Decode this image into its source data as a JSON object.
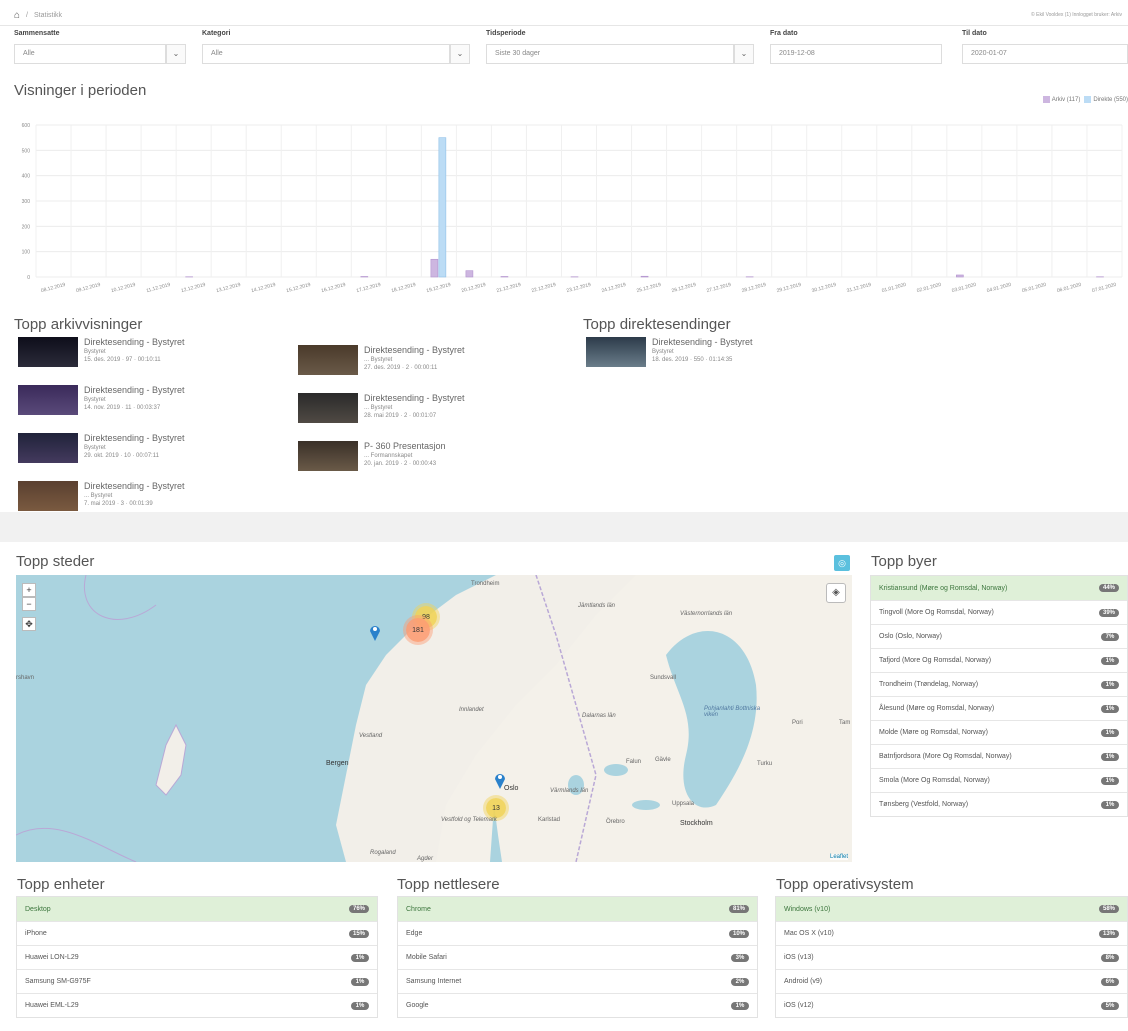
{
  "breadcrumb": {
    "home_icon": "home-icon",
    "current": "Statistikk"
  },
  "header_right": "© Ekil Vooldex (1) Innlogget bruker: Arkiv",
  "filters": {
    "sammensatt": {
      "label": "Sammensatte",
      "value": "Alle"
    },
    "kategori": {
      "label": "Kategori",
      "value": "Alle"
    },
    "tidsperiode": {
      "label": "Tidsperiode",
      "value": "Siste 30 dager"
    },
    "fra_dato": {
      "label": "Fra dato",
      "value": "2019-12-08"
    },
    "til_dato": {
      "label": "Til dato",
      "value": "2020-01-07"
    }
  },
  "views": {
    "title": "Visninger i perioden",
    "legend": [
      "Arkiv (117)",
      "Direkte (550)"
    ]
  },
  "chart_data": {
    "type": "bar",
    "ylim": [
      0,
      600
    ],
    "yticks": [
      0,
      100,
      200,
      300,
      400,
      500,
      600
    ],
    "categories": [
      "08.12.2019",
      "09.12.2019",
      "10.12.2019",
      "11.12.2019",
      "12.12.2019",
      "13.12.2019",
      "14.12.2019",
      "15.12.2019",
      "16.12.2019",
      "17.12.2019",
      "18.12.2019",
      "19.12.2019",
      "20.12.2019",
      "21.12.2019",
      "22.12.2019",
      "23.12.2019",
      "24.12.2019",
      "25.12.2019",
      "26.12.2019",
      "27.12.2019",
      "28.12.2019",
      "29.12.2019",
      "30.12.2019",
      "31.12.2019",
      "01.01.2020",
      "02.01.2020",
      "03.01.2020",
      "04.01.2020",
      "05.01.2020",
      "06.01.2020",
      "07.01.2020"
    ],
    "series": [
      {
        "name": "Arkiv",
        "color": "#cdb6e0",
        "values": [
          0,
          0,
          0,
          0,
          1,
          0,
          0,
          0,
          0,
          2,
          0,
          70,
          25,
          2,
          0,
          1,
          0,
          3,
          0,
          0,
          1,
          0,
          0,
          0,
          0,
          0,
          8,
          0,
          0,
          0,
          1
        ]
      },
      {
        "name": "Direkte",
        "color": "#bcdcf5",
        "values": [
          0,
          0,
          0,
          0,
          0,
          0,
          0,
          0,
          0,
          0,
          0,
          550,
          0,
          0,
          0,
          0,
          0,
          0,
          0,
          0,
          0,
          0,
          0,
          0,
          0,
          0,
          0,
          0,
          0,
          0,
          0
        ]
      }
    ]
  },
  "arkiv": {
    "title": "Topp arkivvisninger",
    "items": [
      {
        "title": "Direktesending - Bystyret",
        "sub": "Bystyret",
        "meta": "15. des. 2019 · 97 · 00:10:11"
      },
      {
        "title": "Direktesending - Bystyret",
        "sub": "Bystyret",
        "meta": "14. nov. 2019 · 11 · 00:03:37"
      },
      {
        "title": "Direktesending - Bystyret",
        "sub": "Bystyret",
        "meta": "29. okt. 2019 · 10 · 00:07:11"
      },
      {
        "title": "Direktesending - Bystyret",
        "sub": "... Bystyret",
        "meta": "7. mai 2019 · 3 · 00:01:39"
      },
      {
        "title": "Direktesending - Bystyret",
        "sub": "... Bystyret",
        "meta": "27. des. 2019 · 2 · 00:00:11"
      },
      {
        "title": "Direktesending - Bystyret",
        "sub": "... Bystyret",
        "meta": "28. mai 2019 · 2 · 00:01:07"
      },
      {
        "title": "P- 360 Presentasjon",
        "sub": "... Formannskapet",
        "meta": "20. jan. 2019 · 2 · 00:00:43"
      }
    ]
  },
  "direkte": {
    "title": "Topp direktesendinger",
    "items": [
      {
        "title": "Direktesending - Bystyret",
        "sub": "Bystyret",
        "meta": "18. des. 2019 · 550 · 01:14:35"
      }
    ]
  },
  "steder": {
    "title": "Topp steder",
    "clusters": [
      "98",
      "181",
      "13"
    ],
    "labels": {
      "trondheim": "Trondheim",
      "bergen": "Bergen",
      "oslo": "Oslo",
      "stockholm": "Stockholm",
      "uppsala": "Uppsala",
      "sundsvall": "Sundsvall",
      "gavle": "Gävle",
      "falun": "Falun",
      "karlstad": "Karlstad",
      "orebro": "Örebro",
      "vastra": "Västra Götalands län",
      "pori": "Pori",
      "turku": "Turku",
      "tampere": "Tam",
      "gulf": "Pohjanlahti Bottniska viken",
      "leaflet": "Leaflet",
      "rogaland": "Rogaland",
      "innlandet": "Innlandet",
      "vestland": "Vestland",
      "dalarnas": "Dalarnas län",
      "agder": "Agder",
      "vestfold": "Vestfold og Telemark",
      "varmland": "Värmlands län",
      "uppsala_lan": "Uppsala län",
      "vastmanland": "Västmanlands län",
      "jamtland": "Jämtlands län",
      "vasternorr": "Västernorrlands län",
      "lappi": "Lappi",
      "haugesund": "rshavn",
      "fjor": "Fjord"
    }
  },
  "byer": {
    "title": "Topp byer",
    "items": [
      {
        "label": "Kristiansund (Møre og Romsdal, Norway)",
        "pct": "44%"
      },
      {
        "label": "Tingvoll (More Og Romsdal, Norway)",
        "pct": "39%"
      },
      {
        "label": "Oslo (Oslo, Norway)",
        "pct": "7%"
      },
      {
        "label": "Tafjord (More Og Romsdal, Norway)",
        "pct": "1%"
      },
      {
        "label": "Trondheim (Trøndelag, Norway)",
        "pct": "1%"
      },
      {
        "label": "Ålesund (Møre og Romsdal, Norway)",
        "pct": "1%"
      },
      {
        "label": "Molde (Møre og Romsdal, Norway)",
        "pct": "1%"
      },
      {
        "label": "Batnfjordsora (More Og Romsdal, Norway)",
        "pct": "1%"
      },
      {
        "label": "Smola (More Og Romsdal, Norway)",
        "pct": "1%"
      },
      {
        "label": "Tønsberg (Vestfold, Norway)",
        "pct": "1%"
      }
    ]
  },
  "enheter": {
    "title": "Topp enheter",
    "items": [
      {
        "label": "Desktop",
        "pct": "76%"
      },
      {
        "label": "iPhone",
        "pct": "15%"
      },
      {
        "label": "Huawei LON-L29",
        "pct": "1%"
      },
      {
        "label": "Samsung SM-G975F",
        "pct": "1%"
      },
      {
        "label": "Huawei EML-L29",
        "pct": "1%"
      }
    ]
  },
  "nettlesere": {
    "title": "Topp nettlesere",
    "items": [
      {
        "label": "Chrome",
        "pct": "81%"
      },
      {
        "label": "Edge",
        "pct": "10%"
      },
      {
        "label": "Mobile Safari",
        "pct": "3%"
      },
      {
        "label": "Samsung Internet",
        "pct": "2%"
      },
      {
        "label": "Google",
        "pct": "1%"
      }
    ]
  },
  "os": {
    "title": "Topp operativsystem",
    "items": [
      {
        "label": "Windows (v10)",
        "pct": "58%"
      },
      {
        "label": "Mac OS X (v10)",
        "pct": "13%"
      },
      {
        "label": "iOS (v13)",
        "pct": "8%"
      },
      {
        "label": "Android (v9)",
        "pct": "6%"
      },
      {
        "label": "iOS (v12)",
        "pct": "5%"
      }
    ]
  }
}
